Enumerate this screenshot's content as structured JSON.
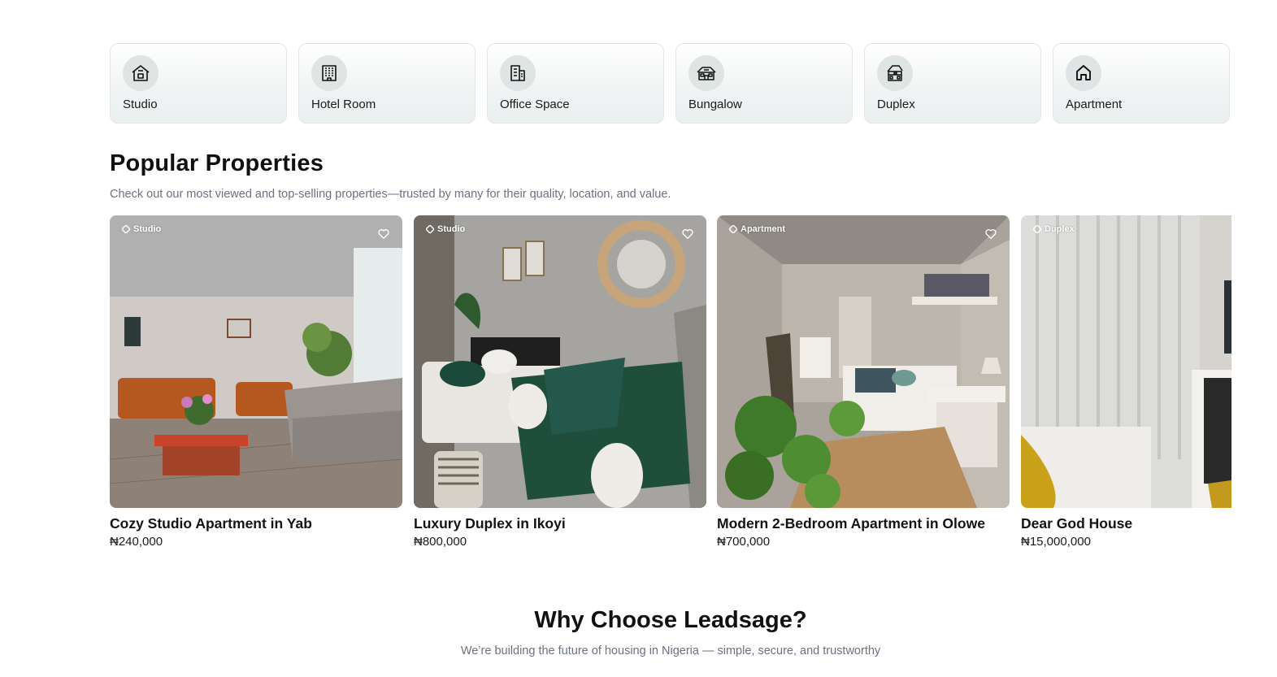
{
  "categories": [
    {
      "label": "Studio",
      "icon": "house-icon"
    },
    {
      "label": "Hotel Room",
      "icon": "hotel-building-icon"
    },
    {
      "label": "Office Space",
      "icon": "office-building-icon"
    },
    {
      "label": "Bungalow",
      "icon": "bungalow-icon"
    },
    {
      "label": "Duplex",
      "icon": "duplex-icon"
    },
    {
      "label": "Apartment",
      "icon": "home-icon"
    }
  ],
  "popular": {
    "title": "Popular Properties",
    "subtitle": "Check out our most viewed and top-selling properties—trusted by many for their quality, location, and value.",
    "items": [
      {
        "badge": "Studio",
        "title": "Cozy Studio Apartment in Yab",
        "price": "₦240,000"
      },
      {
        "badge": "Studio",
        "title": "Luxury Duplex in Ikoyi",
        "price": "₦800,000"
      },
      {
        "badge": "Apartment",
        "title": "Modern 2-Bedroom Apartment in Olowe",
        "price": "₦700,000"
      },
      {
        "badge": "Duplex",
        "title": "Dear God House",
        "price": "₦15,000,000"
      }
    ]
  },
  "why": {
    "title": "Why Choose Leadsage?",
    "subtitle": "We’re building the future of housing in Nigeria — simple, secure, and trustworthy"
  }
}
